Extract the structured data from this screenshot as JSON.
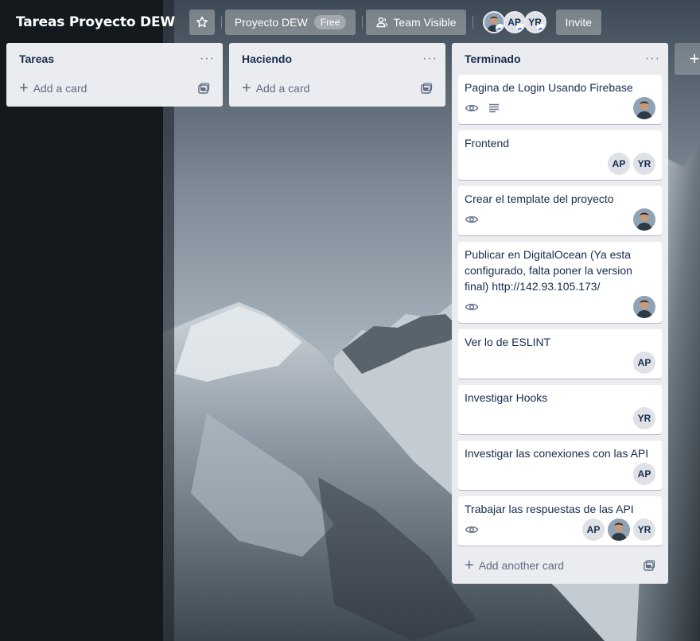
{
  "board": {
    "title": "Tareas Proyecto DEW",
    "star_icon": "star-icon",
    "workspace_label": "Proyecto DEW",
    "workspace_badge": "Free",
    "visibility_label": "Team Visible",
    "visibility_icon": "team-icon",
    "members": [
      {
        "kind": "photo",
        "initials": ""
      },
      {
        "kind": "initials",
        "initials": "AP"
      },
      {
        "kind": "initials",
        "initials": "YR"
      }
    ],
    "invite_label": "Invite"
  },
  "lists": [
    {
      "name": "Tareas",
      "menu": "···",
      "add_label": "Add a card",
      "cards": []
    },
    {
      "name": "Haciendo",
      "menu": "···",
      "add_label": "Add a card",
      "cards": []
    },
    {
      "name": "Terminado",
      "menu": "···",
      "add_label": "Add another card",
      "cards": [
        {
          "title": "Pagina de Login Usando Firebase",
          "badges": [
            "watch-icon",
            "description-icon"
          ],
          "members": [
            "photo"
          ]
        },
        {
          "title": "Frontend",
          "badges": [],
          "members": [
            "AP",
            "YR"
          ]
        },
        {
          "title": "Crear el template del proyecto",
          "badges": [
            "watch-icon"
          ],
          "members": [
            "photo"
          ]
        },
        {
          "title": "Publicar en DigitalOcean (Ya esta configurado, falta poner la version final) http://142.93.105.173/",
          "badges": [
            "watch-icon"
          ],
          "members": [
            "photo"
          ]
        },
        {
          "title": "Ver lo de ESLINT",
          "badges": [],
          "members": [
            "AP"
          ]
        },
        {
          "title": "Investigar Hooks",
          "badges": [],
          "members": [
            "YR"
          ]
        },
        {
          "title": "Investigar las conexiones con las API",
          "badges": [],
          "members": [
            "AP"
          ]
        },
        {
          "title": "Trabajar las respuestas de las API",
          "badges": [
            "watch-icon"
          ],
          "members": [
            "AP",
            "photo",
            "YR"
          ]
        }
      ]
    }
  ],
  "add_list": "+",
  "colors": {
    "list_bg": "#ebecf0",
    "card_bg": "#ffffff",
    "avatar_bg": "#dfe1e6",
    "text": "#172b4d",
    "muted": "#5e6c84"
  }
}
